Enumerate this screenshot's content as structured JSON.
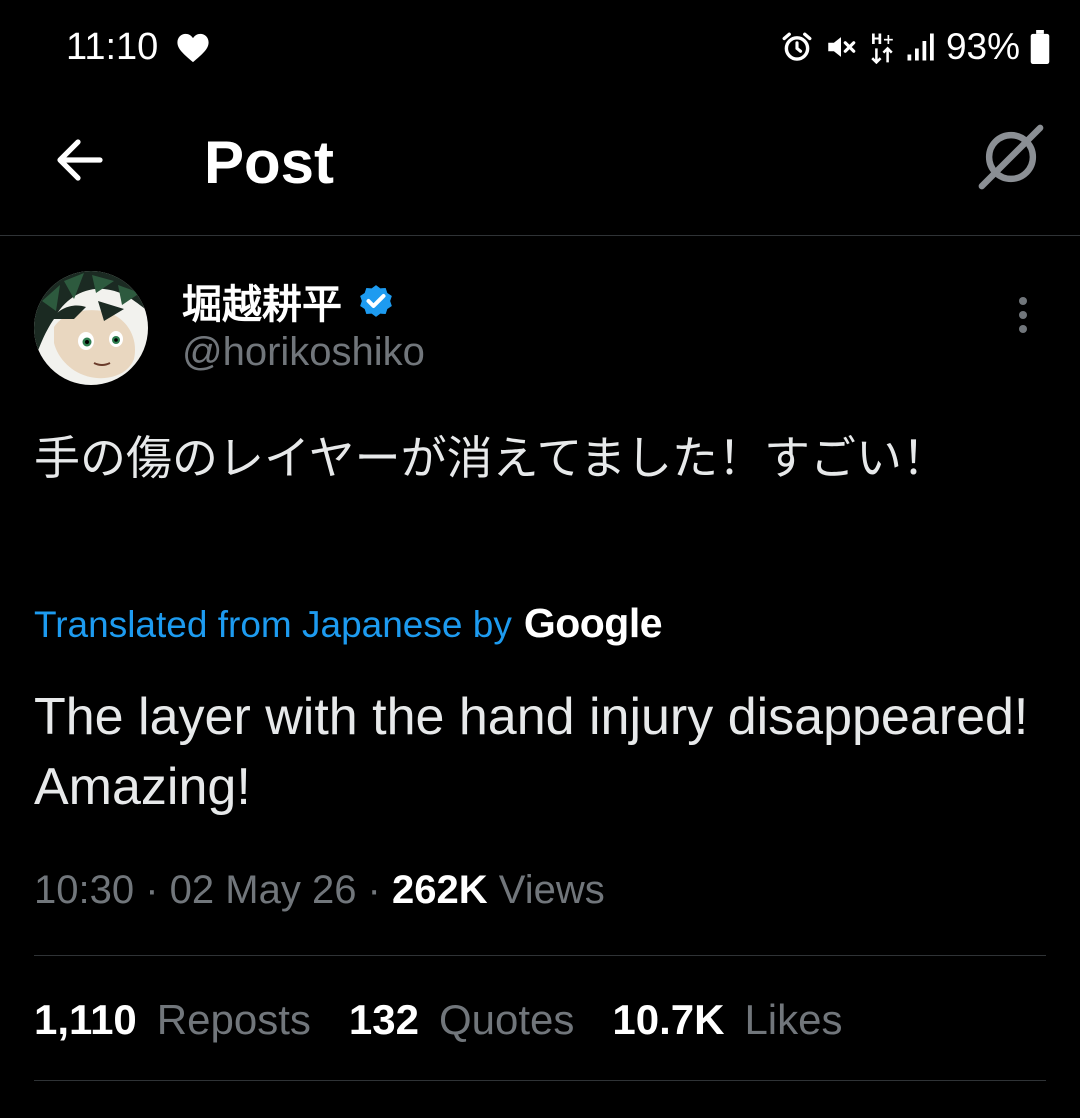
{
  "status_bar": {
    "time": "11:10",
    "battery": "93%"
  },
  "header": {
    "title": "Post"
  },
  "author": {
    "name": "堀越耕平",
    "handle": "@horikoshiko"
  },
  "post": {
    "text_original": "手の傷のレイヤーが消えてました！すごい！",
    "translation_label": "Translated from Japanese by",
    "translation_provider": "Google",
    "text_translated": "The layer with the hand injury disappeared! Amazing!"
  },
  "meta": {
    "time": "10:30",
    "date": "02 May 26",
    "views_count": "262K",
    "views_label": "Views"
  },
  "stats": [
    {
      "count": "1,110",
      "label": "Reposts"
    },
    {
      "count": "132",
      "label": "Quotes"
    },
    {
      "count": "10.7K",
      "label": "Likes"
    }
  ],
  "colors": {
    "background": "#000000",
    "accent": "#1d9bf0",
    "secondary_text": "#71767b",
    "divider": "#2f3336"
  },
  "icons": {
    "back": "arrow-left-icon",
    "grok": "grok-icon",
    "verified": "verified-badge-icon",
    "more": "more-vertical-icon"
  }
}
